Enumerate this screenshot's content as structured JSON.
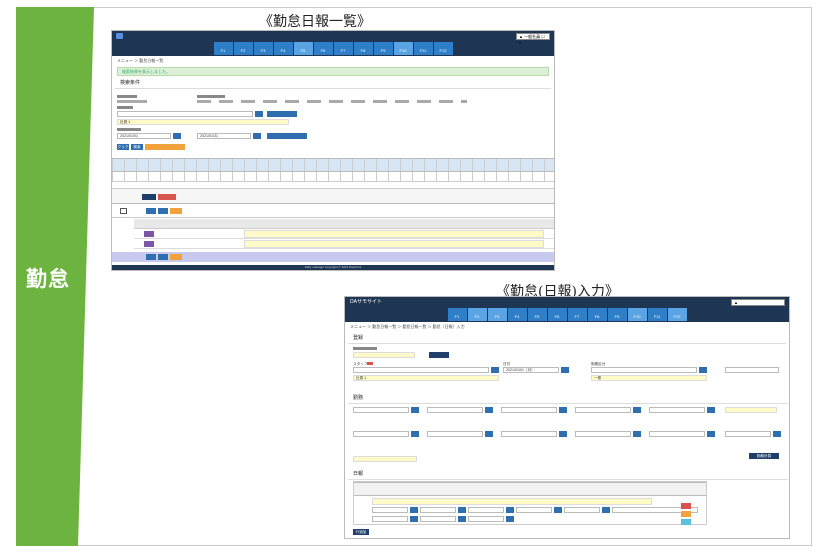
{
  "captions": {
    "list": "《勤怠日報一覧》",
    "entry": "《勤怠(日報)入力》"
  },
  "sidebar": {
    "label": "勤怠",
    "color": "#6db33f"
  },
  "function_keys": [
    "F1",
    "F2",
    "F3",
    "F4",
    "F5",
    "F6",
    "F7",
    "F8",
    "F9",
    "F10",
    "F11",
    "F12"
  ],
  "screen1": {
    "user": "▲ 一般社員 ☐ ▾",
    "breadcrumb": "メニュー ＞ 勤怠日報一覧",
    "alert": "検索結果を表示しました。",
    "search_title": "検索条件",
    "search_button": "検索",
    "clear_button": "クリア",
    "staff_value": "社員 1",
    "date_from": "2021/01/01",
    "date_to": "2021/01/31",
    "footer": "Daily manager Copyright © 2021 DayPoint"
  },
  "screen2": {
    "site": "DAサモサイト",
    "user": "▲",
    "breadcrumb": "メニュー ＞ 勤怠日報一覧 ＞ 勤怠日報一覧 ＞ 勤怠（日報）入力",
    "sec_register": "登録",
    "sec_work": "勤務",
    "sec_daily": "日報",
    "staff_label": "スタッフ",
    "staff_value": "社員 1",
    "date_label": "日付",
    "date_value": "2021/01/01（月）",
    "attendance_label": "勤務区分",
    "attendance_value": "一般",
    "add_button": "行追加",
    "check_button": "勤務計算"
  }
}
